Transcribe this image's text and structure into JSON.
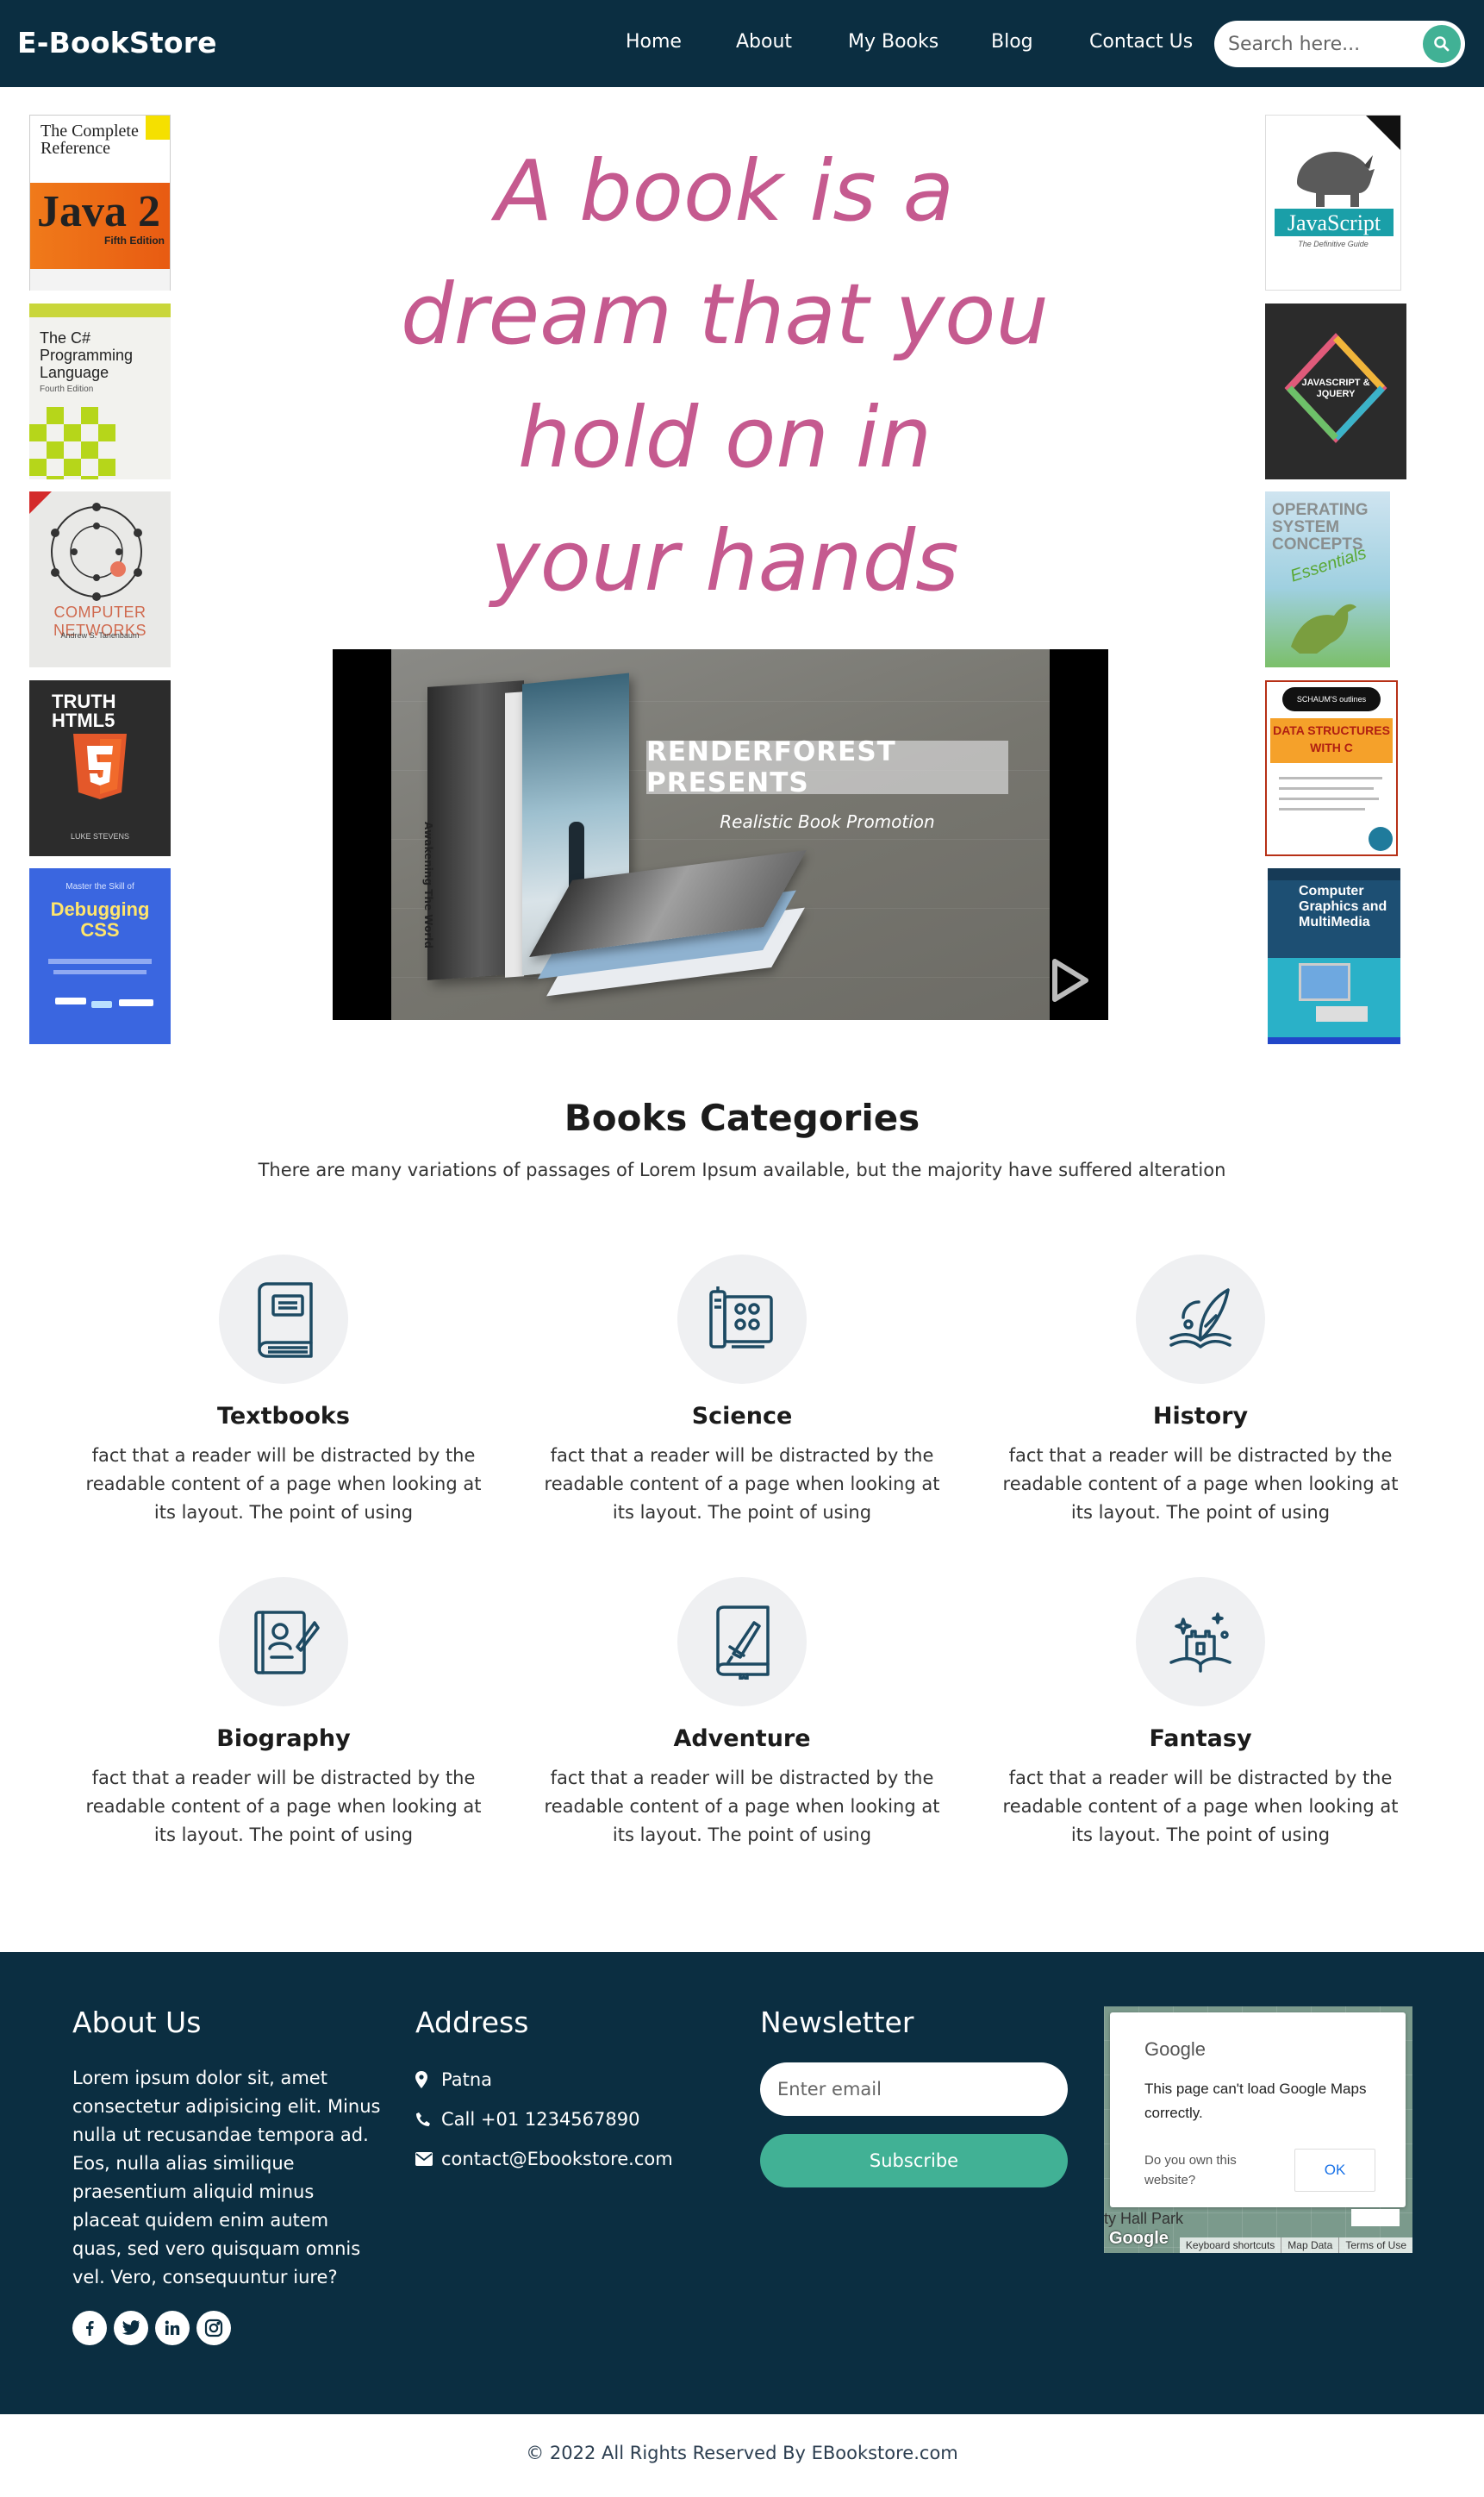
{
  "header": {
    "brand": "E-BookStore",
    "nav": [
      "Home",
      "About",
      "My Books",
      "Blog",
      "Contact Us"
    ],
    "search_placeholder": "Search here..."
  },
  "books_left": [
    {
      "title": "The Complete Reference",
      "subtitle": "Java 2",
      "edition": "Fifth Edition"
    },
    {
      "title": "The C# Programming Language",
      "subtitle": "Fourth Edition"
    },
    {
      "title": "COMPUTER NETWORKS",
      "subtitle": "Andrew S. Tanenbaum"
    },
    {
      "title": "TRUTH HTML5",
      "subtitle": "LUKE STEVENS"
    },
    {
      "title": "Debugging CSS",
      "subtitle": "Master the Skill of"
    }
  ],
  "books_right": [
    {
      "title": "JavaScript",
      "subtitle": "The Definitive Guide"
    },
    {
      "title": "JAVASCRIPT & JQUERY",
      "subtitle": ""
    },
    {
      "title": "OPERATING SYSTEM CONCEPTS",
      "subtitle": "Essentials"
    },
    {
      "title": "DATA STRUCTURES WITH C",
      "subtitle": "SCHAUM'S outlines"
    },
    {
      "title": "Computer Graphics and MultiMedia",
      "subtitle": ""
    }
  ],
  "hero": {
    "quote_lines": [
      "A book is a",
      "dream that you",
      "hold on in",
      "your hands"
    ]
  },
  "video": {
    "headline": "RENDERFOREST PRESENTS",
    "subline": "Realistic Book Promotion",
    "book_spine": "Awakening The World"
  },
  "categories": {
    "title": "Books Categories",
    "subtitle": "There are many variations of passages of Lorem Ipsum available, but the majority have suffered alteration",
    "items": [
      {
        "name": "Textbooks",
        "icon": "book-icon",
        "desc": "fact that a reader will be distracted by the readable content of a page when looking at its layout. The point of using"
      },
      {
        "name": "Science",
        "icon": "lab-device-icon",
        "desc": "fact that a reader will be distracted by the readable content of a page when looking at its layout. The point of using"
      },
      {
        "name": "History",
        "icon": "quill-book-icon",
        "desc": "fact that a reader will be distracted by the readable content of a page when looking at its layout. The point of using"
      },
      {
        "name": "Biography",
        "icon": "profile-book-icon",
        "desc": "fact that a reader will be distracted by the readable content of a page when looking at its layout. The point of using"
      },
      {
        "name": "Adventure",
        "icon": "sword-book-icon",
        "desc": "fact that a reader will be distracted by the readable content of a page when looking at its layout. The point of using"
      },
      {
        "name": "Fantasy",
        "icon": "castle-book-icon",
        "desc": "fact that a reader will be distracted by the readable content of a page when looking at its layout. The point of using"
      }
    ]
  },
  "footer": {
    "about_title": "About Us",
    "about_text": "Lorem ipsum dolor sit, amet consectetur adipisicing elit. Minus nulla ut recusandae tempora ad. Eos, nulla alias similique praesentium aliquid minus placeat quidem enim autem quas, sed vero quisquam omnis vel. Vero, consequuntur iure?",
    "social": [
      "facebook-icon",
      "twitter-icon",
      "linkedin-icon",
      "instagram-icon"
    ],
    "address_title": "Address",
    "address": {
      "city": "Patna",
      "phone": "Call +01 1234567890",
      "email": "contact@Ebookstore.com"
    },
    "newsletter_title": "Newsletter",
    "email_placeholder": "Enter email",
    "subscribe_label": "Subscribe",
    "map": {
      "brand": "Google",
      "message": "This page can't load Google Maps correctly.",
      "own_site": "Do you own this website?",
      "ok_label": "OK",
      "park_label": "ty Hall Park",
      "logo": "Google",
      "links": [
        "Keyboard shortcuts",
        "Map Data",
        "Terms of Use"
      ]
    }
  },
  "copyright": "© 2022 All Rights Reserved By EBookstore.com",
  "colors": {
    "navy": "#0b2e41",
    "accent_green": "#41b195",
    "quote_pink": "#c55a8f"
  }
}
